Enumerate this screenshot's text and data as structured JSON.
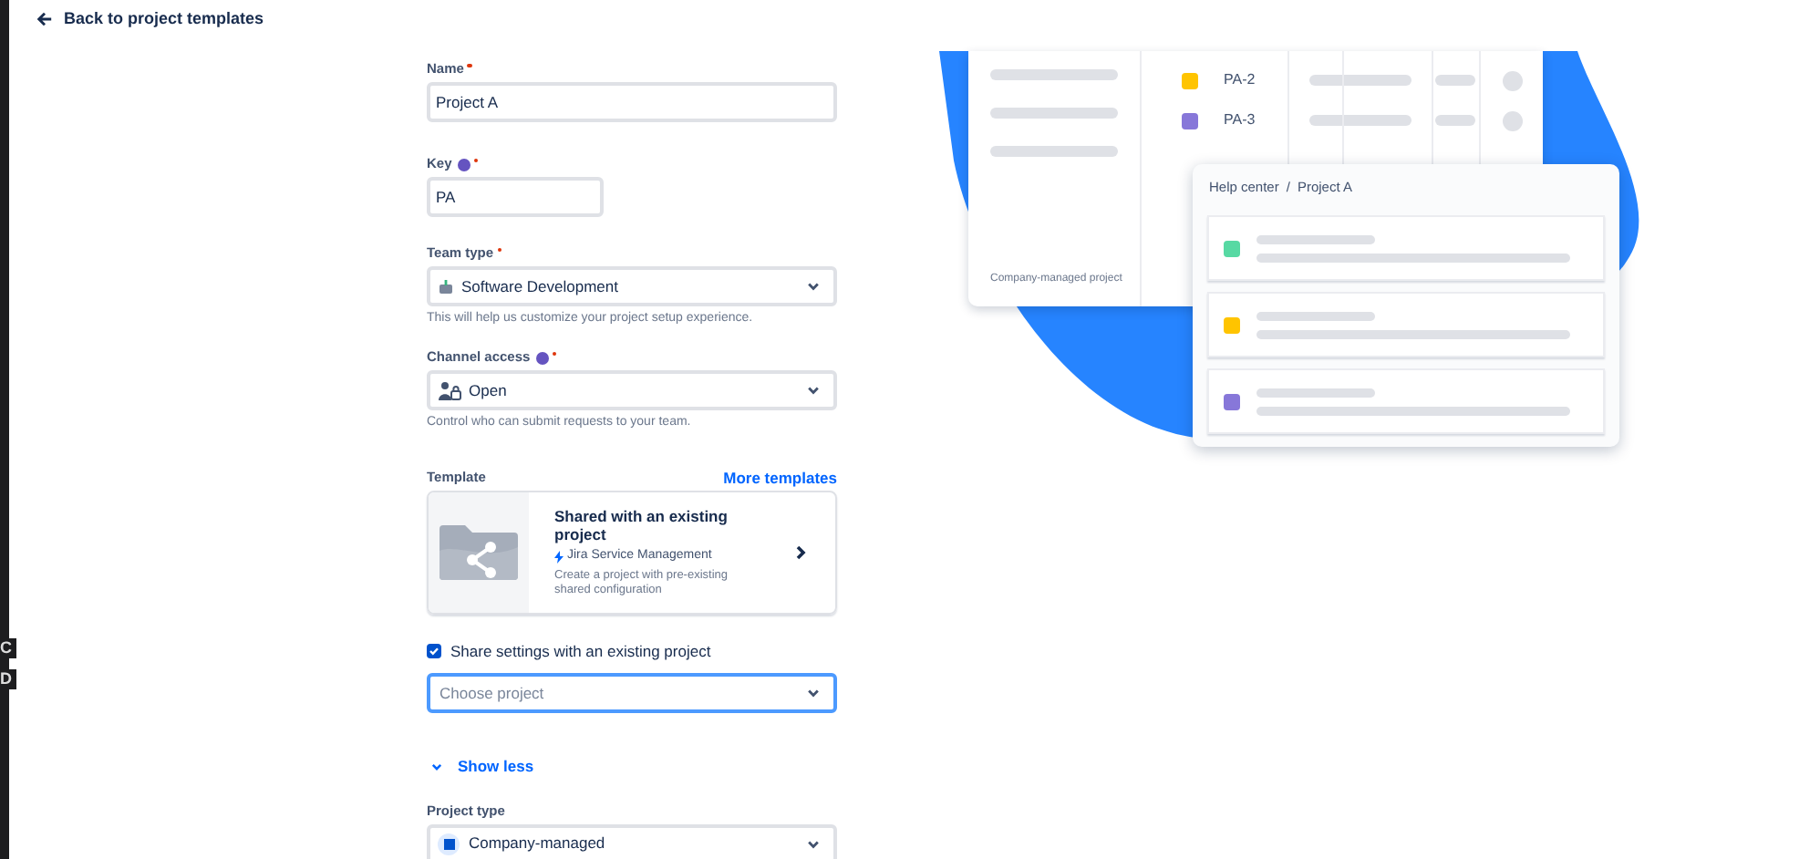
{
  "edge_text": [
    "C",
    "D"
  ],
  "back_link": "Back to project templates",
  "fields": [
    {
      "kind": "input",
      "label": "Name",
      "required": true,
      "info": false,
      "value": "Project A",
      "wide": true
    },
    {
      "kind": "input",
      "label": "Key",
      "required": true,
      "info": true,
      "value": "PA",
      "wide": false
    },
    {
      "kind": "select",
      "label": "Team type",
      "required": true,
      "info": false,
      "value": "Software Development",
      "help": "This will help us customize your project setup experience."
    },
    {
      "kind": "select",
      "label": "Channel access",
      "required": true,
      "info": true,
      "value": "Open",
      "help": "Control who can submit requests to your team."
    }
  ],
  "template": {
    "label": "Template",
    "link": "More templates",
    "title": "Shared with an existing project",
    "product": "Jira Service Management",
    "description": "Create a project with pre-existing shared configuration"
  },
  "share_checkbox": {
    "label": "Share settings with an existing project",
    "checked": true
  },
  "choose_project": {
    "placeholder": "Choose project",
    "focused": true
  },
  "toggle": {
    "label": "Show less",
    "expanded": true
  },
  "project_type": {
    "label": "Project type",
    "value": "Company-managed"
  },
  "illustration": {
    "issues": [
      {
        "key": "PA-2",
        "color": "#ffc400"
      },
      {
        "key": "PA-3",
        "color": "#8777d9"
      }
    ],
    "footer": "Company-managed project",
    "breadcrumb": [
      "Help center",
      "/",
      "Project A"
    ],
    "requests": [
      {
        "color": "#57d9a3"
      },
      {
        "color": "#ffc400"
      },
      {
        "color": "#8777d9"
      }
    ]
  }
}
